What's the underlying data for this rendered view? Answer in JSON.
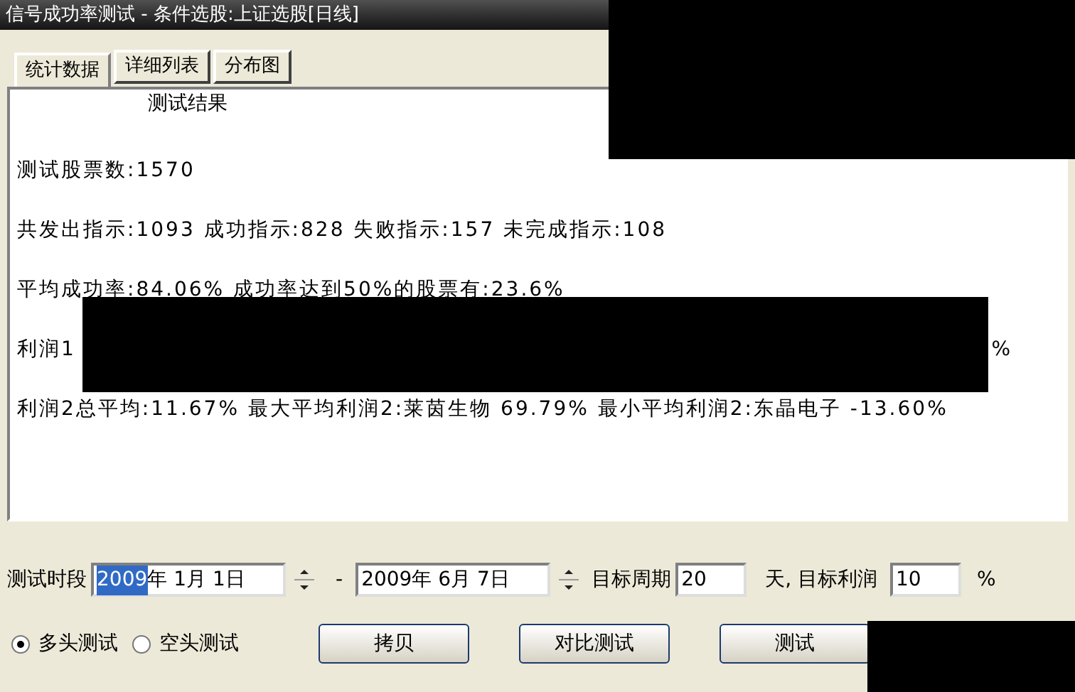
{
  "window": {
    "title": "信号成功率测试 - 条件选股:上证选股[日线]"
  },
  "tabs": [
    {
      "label": "统计数据",
      "selected": true
    },
    {
      "label": "详细列表",
      "selected": false
    },
    {
      "label": "分布图",
      "selected": false
    }
  ],
  "results": {
    "heading": "测试结果",
    "lines": [
      "测试股票数:1570",
      "共发出指示:1093 成功指示:828 失败指示:157 未完成指示:108",
      "平均成功率:84.06% 成功率达到50%的股票有:23.6%"
    ],
    "profit1": {
      "label": "利润1",
      "tail": "%"
    },
    "profit2": "利润2总平均:11.67% 最大平均利润2:莱茵生物 69.79% 最小平均利润2:东晶电子 -13.60%"
  },
  "period": {
    "label": "测试时段",
    "start_year": "2009",
    "start_rest": "年 1月 1日",
    "separator": "-",
    "end": "2009年 6月 7日",
    "target_period_label": "目标周期",
    "target_period": "20",
    "target_profit_label": "天, 目标利润",
    "target_profit": "10",
    "percent": "%"
  },
  "modes": [
    {
      "label": "多头测试",
      "selected": true
    },
    {
      "label": "空头测试",
      "selected": false
    }
  ],
  "buttons": [
    "拷贝",
    "对比测试",
    "测试"
  ]
}
